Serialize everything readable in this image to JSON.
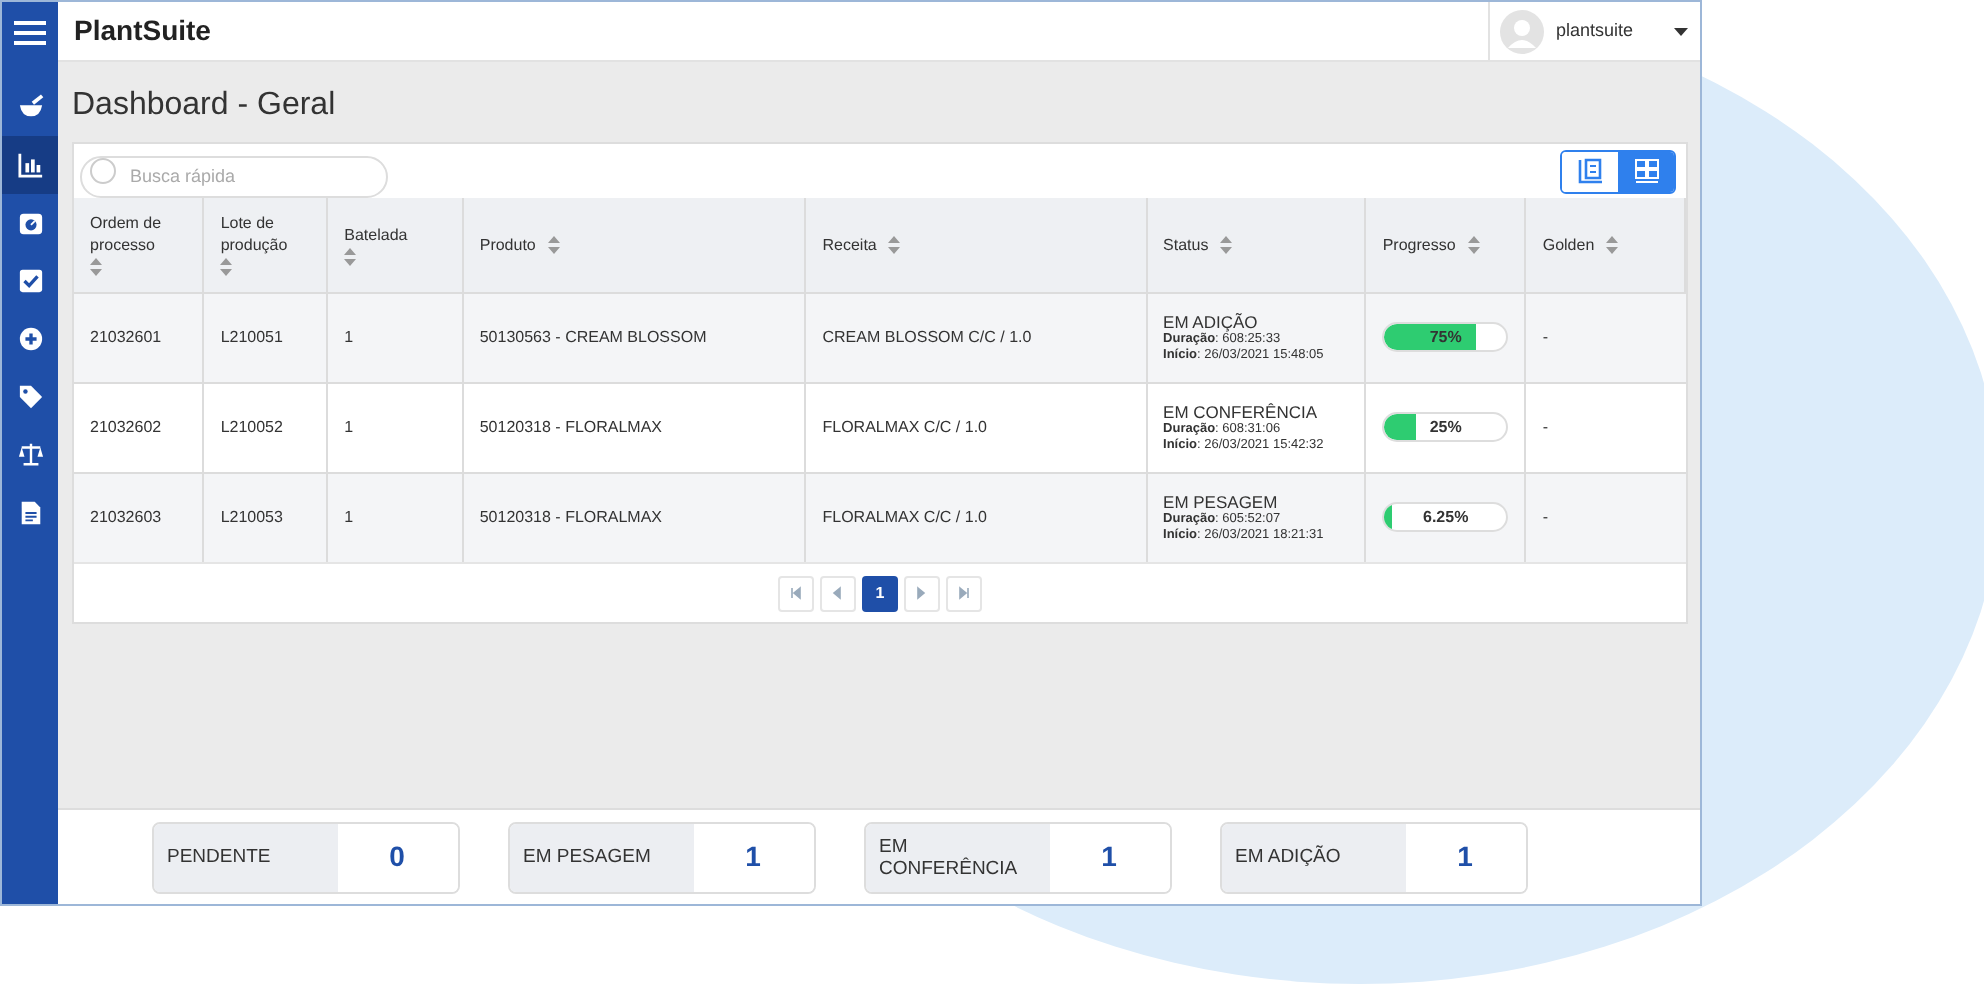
{
  "app": {
    "title": "PlantSuite",
    "user": "plantsuite"
  },
  "sidebar": {
    "items": [
      {
        "kind": "mortar",
        "selected": false
      },
      {
        "kind": "chart",
        "selected": true
      },
      {
        "kind": "dial",
        "selected": false
      },
      {
        "kind": "check",
        "selected": false
      },
      {
        "kind": "plus",
        "selected": false
      },
      {
        "kind": "tag",
        "selected": false
      },
      {
        "kind": "balance",
        "selected": false
      },
      {
        "kind": "document",
        "selected": false
      }
    ]
  },
  "page_title": "Dashboard - Geral",
  "search": {
    "placeholder": "Busca rápida"
  },
  "view_toggle": [
    {
      "kind": "list",
      "selected": false
    },
    {
      "kind": "grid",
      "selected": true
    }
  ],
  "table": {
    "columns": [
      "Ordem de processo",
      "Lote de produção",
      "Batelada",
      "Produto",
      "Receita",
      "Status",
      "Progresso",
      "Golden"
    ],
    "rows": [
      {
        "ordem": "21032601",
        "lote": "L210051",
        "batelada": "1",
        "produto": "50130563 - CREAM BLOSSOM",
        "receita": "CREAM BLOSSOM C/C / 1.0",
        "status": "EM ADIÇÃO",
        "duracao": "**Duração**: 608:25:33",
        "inicio": "**Início**: 26/03/2021 15:48:05",
        "level": 0.75,
        "progress": "75%",
        "golden": "-"
      },
      {
        "ordem": "21032602",
        "lote": "L210052",
        "batelada": "1",
        "produto": "50120318 - FLORALMAX",
        "receita": "FLORALMAX C/C / 1.0",
        "status": "EM CONFERÊNCIA",
        "duracao": "**Duração**: 608:31:06",
        "inicio": "**Início**: 26/03/2021 15:42:32",
        "level": 0.25,
        "progress": "25%",
        "golden": "-"
      },
      {
        "ordem": "21032603",
        "lote": "L210053",
        "batelada": "1",
        "produto": "50120318 - FLORALMAX",
        "receita": "FLORALMAX C/C / 1.0",
        "status": "EM PESAGEM",
        "duracao": "**Duração**: 605:52:07",
        "inicio": "**Início**: 26/03/2021 18:21:31",
        "level": 0.0625,
        "progress": "6.25%",
        "golden": "-"
      }
    ]
  },
  "pagination": [
    {
      "kind": "first"
    },
    {
      "kind": "prev"
    },
    {
      "kind": "page",
      "label": "1",
      "selected": true
    },
    {
      "kind": "next"
    },
    {
      "kind": "last"
    }
  ],
  "summary": [
    {
      "label": "PENDENTE",
      "count": "0"
    },
    {
      "label": "EM PESAGEM",
      "count": "1"
    },
    {
      "label": "EM CONFERÊNCIA",
      "count": "1"
    },
    {
      "label": "EM ADIÇÃO",
      "count": "1"
    }
  ]
}
